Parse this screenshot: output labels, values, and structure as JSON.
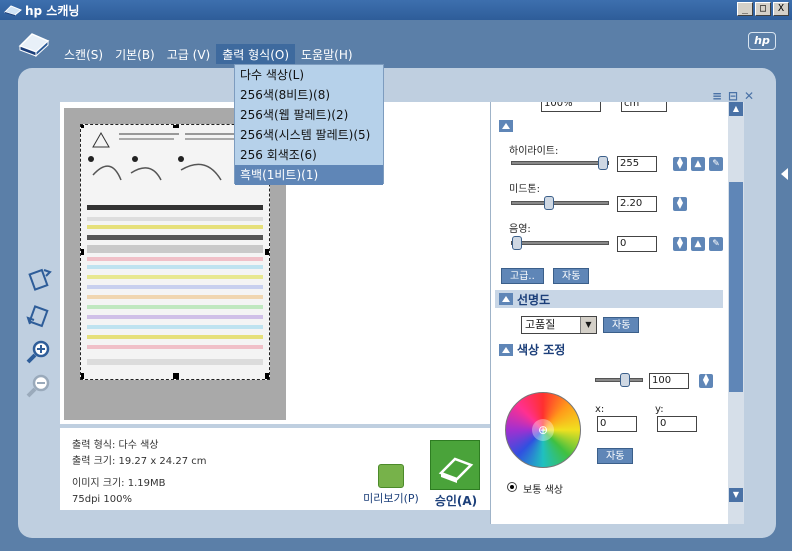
{
  "window": {
    "title": "hp 스캐닝",
    "buttons": [
      "_",
      "□",
      "X"
    ]
  },
  "brand": {
    "logo_text": "hp"
  },
  "menu": {
    "items": [
      {
        "label": "스캔(S)"
      },
      {
        "label": "기본(B)"
      },
      {
        "label": "고급 (V)"
      },
      {
        "label": "출력 형식(O)"
      },
      {
        "label": "도움말(H)"
      }
    ],
    "active_index": 3
  },
  "output_menu": {
    "items": [
      {
        "label": "다수 색상(L)"
      },
      {
        "label": "256색(8비트)(8)"
      },
      {
        "label": "256색(웹 팔레트)(2)"
      },
      {
        "label": "256색(시스템 팔레트)(5)"
      },
      {
        "label": "256 회색조(6)"
      },
      {
        "label": "흑백(1비트)(1)"
      }
    ],
    "selected_index": 5
  },
  "info": {
    "output_format": "출력 형식: 다수 색상",
    "output_size": "출력 크기: 19.27 x 24.27 cm",
    "image_size": "이미지 크기: 1.19MB",
    "resolution": "75dpi  100%"
  },
  "actions": {
    "preview_label": "미리보기(P)",
    "accept_label": "승인(A)"
  },
  "settings": {
    "top_fields": [
      "100%",
      "cm"
    ],
    "highlight": {
      "label": "하이라이트:",
      "value": "255"
    },
    "midtone": {
      "label": "미드톤:",
      "value": "2.20"
    },
    "shadow": {
      "label": "음영:",
      "value": "0"
    },
    "advanced_button": "고급..",
    "auto_button": "자동",
    "sharpness": {
      "title": "선명도",
      "select_value": "고품질",
      "auto_button": "자동"
    },
    "color_adjust": {
      "title": "색상 조정",
      "saturation_value": "100",
      "x_label": "x:",
      "x_value": "0",
      "y_label": "y:",
      "y_value": "0",
      "auto_button": "자동",
      "radio_label": "보통 색상"
    }
  }
}
